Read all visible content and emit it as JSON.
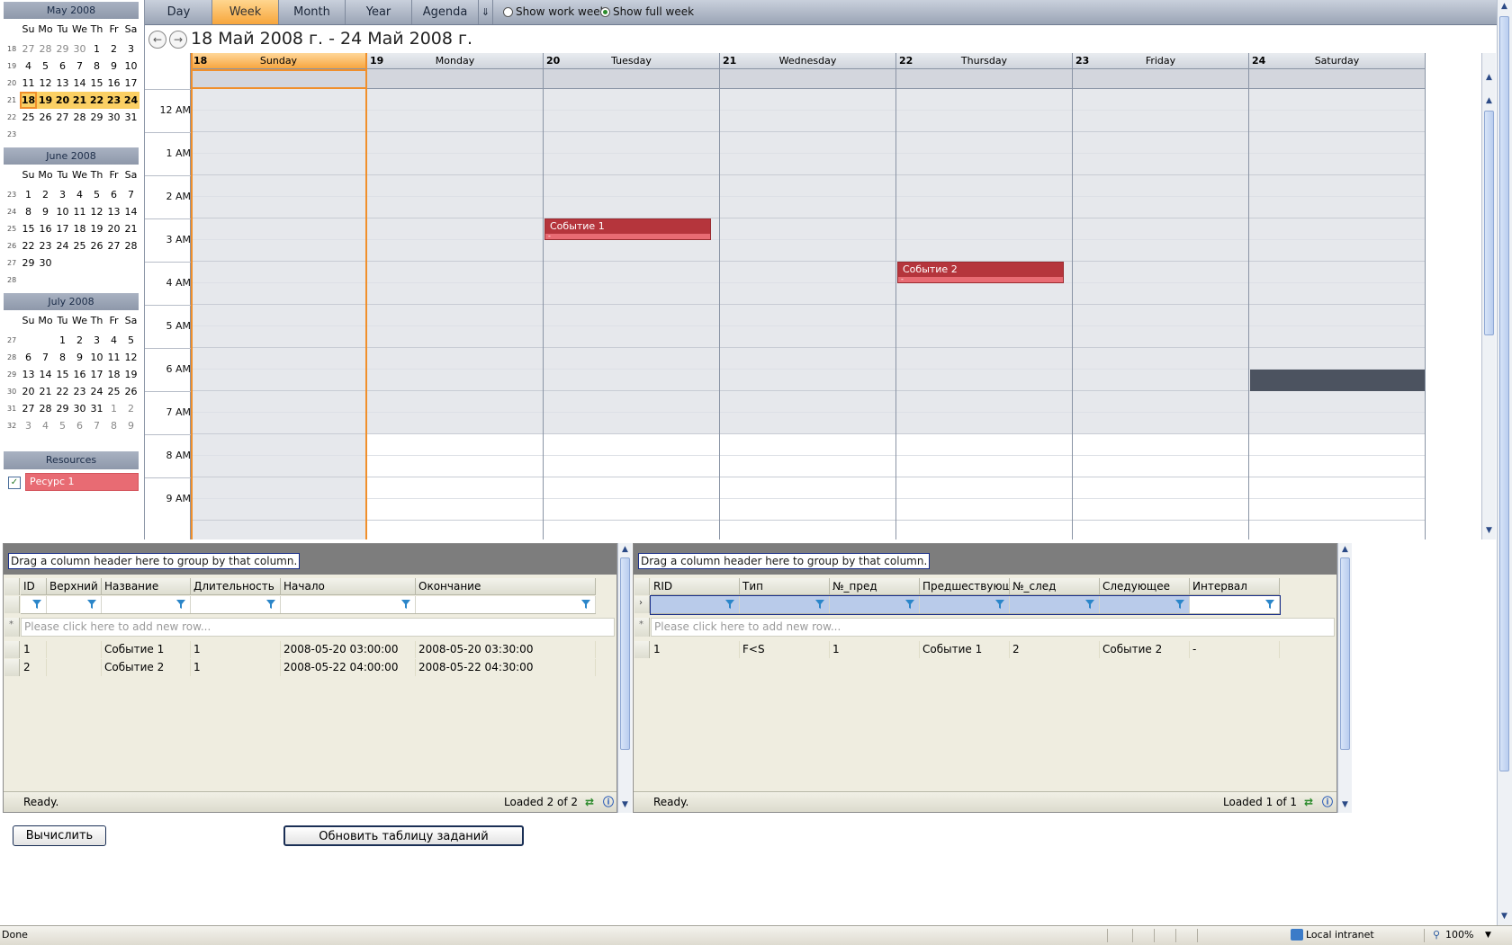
{
  "mini_calendars": [
    {
      "title": "May 2008",
      "weeks": [
        {
          "wk": "18",
          "days": [
            "27",
            "28",
            "29",
            "30",
            "1",
            "2",
            "3"
          ],
          "other": [
            0,
            1,
            2,
            3
          ]
        },
        {
          "wk": "19",
          "days": [
            "4",
            "5",
            "6",
            "7",
            "8",
            "9",
            "10"
          ],
          "other": []
        },
        {
          "wk": "20",
          "days": [
            "11",
            "12",
            "13",
            "14",
            "15",
            "16",
            "17"
          ],
          "other": []
        },
        {
          "wk": "21",
          "days": [
            "18",
            "19",
            "20",
            "21",
            "22",
            "23",
            "24"
          ],
          "other": []
        },
        {
          "wk": "22",
          "days": [
            "25",
            "26",
            "27",
            "28",
            "29",
            "30",
            "31"
          ],
          "other": []
        },
        {
          "wk": "23",
          "days": [
            "",
            "",
            "",
            "",
            "",
            "",
            ""
          ],
          "other": []
        }
      ]
    },
    {
      "title": "June 2008",
      "weeks": [
        {
          "wk": "23",
          "days": [
            "1",
            "2",
            "3",
            "4",
            "5",
            "6",
            "7"
          ],
          "other": []
        },
        {
          "wk": "24",
          "days": [
            "8",
            "9",
            "10",
            "11",
            "12",
            "13",
            "14"
          ],
          "other": []
        },
        {
          "wk": "25",
          "days": [
            "15",
            "16",
            "17",
            "18",
            "19",
            "20",
            "21"
          ],
          "other": []
        },
        {
          "wk": "26",
          "days": [
            "22",
            "23",
            "24",
            "25",
            "26",
            "27",
            "28"
          ],
          "other": []
        },
        {
          "wk": "27",
          "days": [
            "29",
            "30",
            "",
            "",
            "",
            "",
            ""
          ],
          "other": []
        },
        {
          "wk": "28",
          "days": [
            "",
            "",
            "",
            "",
            "",
            "",
            ""
          ],
          "other": []
        }
      ]
    },
    {
      "title": "July 2008",
      "weeks": [
        {
          "wk": "27",
          "days": [
            "",
            "",
            "1",
            "2",
            "3",
            "4",
            "5"
          ],
          "other": []
        },
        {
          "wk": "28",
          "days": [
            "6",
            "7",
            "8",
            "9",
            "10",
            "11",
            "12"
          ],
          "other": []
        },
        {
          "wk": "29",
          "days": [
            "13",
            "14",
            "15",
            "16",
            "17",
            "18",
            "19"
          ],
          "other": []
        },
        {
          "wk": "30",
          "days": [
            "20",
            "21",
            "22",
            "23",
            "24",
            "25",
            "26"
          ],
          "other": []
        },
        {
          "wk": "31",
          "days": [
            "27",
            "28",
            "29",
            "30",
            "31",
            "1",
            "2"
          ],
          "other": [
            5,
            6
          ]
        },
        {
          "wk": "32",
          "days": [
            "3",
            "4",
            "5",
            "6",
            "7",
            "8",
            "9"
          ],
          "other": [
            0,
            1,
            2,
            3,
            4,
            5,
            6
          ]
        }
      ]
    }
  ],
  "weekday_abbr": [
    "Su",
    "Mo",
    "Tu",
    "We",
    "Th",
    "Fr",
    "Sa"
  ],
  "resources": {
    "title": "Resources",
    "items": [
      {
        "label": "Ресурс 1",
        "checked": true
      }
    ]
  },
  "toolbar": {
    "views": [
      "Day",
      "Week",
      "Month",
      "Year",
      "Agenda"
    ],
    "active_view": "Week",
    "work_week_label": "Show work week",
    "full_week_label": "Show full week",
    "selected_option": "full"
  },
  "date_range": "18 Май 2008 г. - 24 Май 2008 г.",
  "week_days": [
    {
      "num": "18",
      "name": "Sunday"
    },
    {
      "num": "19",
      "name": "Monday"
    },
    {
      "num": "20",
      "name": "Tuesday"
    },
    {
      "num": "21",
      "name": "Wednesday"
    },
    {
      "num": "22",
      "name": "Thursday"
    },
    {
      "num": "23",
      "name": "Friday"
    },
    {
      "num": "24",
      "name": "Saturday"
    }
  ],
  "hours": [
    "12 AM",
    "1 AM",
    "2 AM",
    "3 AM",
    "4 AM",
    "5 AM",
    "6 AM",
    "7 AM",
    "8 AM",
    "9 AM"
  ],
  "events": [
    {
      "title": "Событие 1",
      "sub": "-",
      "day_index": 2,
      "start_hour": 3.0,
      "end_hour": 3.5
    },
    {
      "title": "Событие 2",
      "sub": "-",
      "day_index": 4,
      "start_hour": 4.0,
      "end_hour": 4.5
    }
  ],
  "tasks_grid": {
    "group_hint": "Drag a column header here to group by that column.",
    "columns": [
      "ID",
      "Верхний",
      "Название",
      "Длительность",
      "Начало",
      "Окончание"
    ],
    "add_row": "Please click here to add new row...",
    "rows": [
      [
        "1",
        "",
        "Событие 1",
        "1",
        "2008-05-20 03:00:00",
        "2008-05-20 03:30:00"
      ],
      [
        "2",
        "",
        "Событие 2",
        "1",
        "2008-05-22 04:00:00",
        "2008-05-22 04:30:00"
      ]
    ],
    "status": "Ready.",
    "loaded": "Loaded 2 of 2"
  },
  "links_grid": {
    "group_hint": "Drag a column header here to group by that column.",
    "columns": [
      "RID",
      "Тип",
      "№_пред",
      "Предшествующее",
      "№_след",
      "Следующее",
      "Интервал"
    ],
    "add_row": "Please click here to add new row...",
    "rows": [
      [
        "1",
        "F<S",
        "1",
        "Событие 1",
        "2",
        "Событие 2",
        "-"
      ]
    ],
    "status": "Ready.",
    "loaded": "Loaded 1 of 1"
  },
  "buttons": {
    "calculate": "Вычислить",
    "refresh": "Обновить таблицу заданий"
  },
  "browser_status": {
    "left": "Done",
    "zone": "Local intranet",
    "zoom": "100%"
  },
  "colors": {
    "accent": "#f7a640",
    "event": "#b5353c",
    "resource": "#e86b73"
  }
}
